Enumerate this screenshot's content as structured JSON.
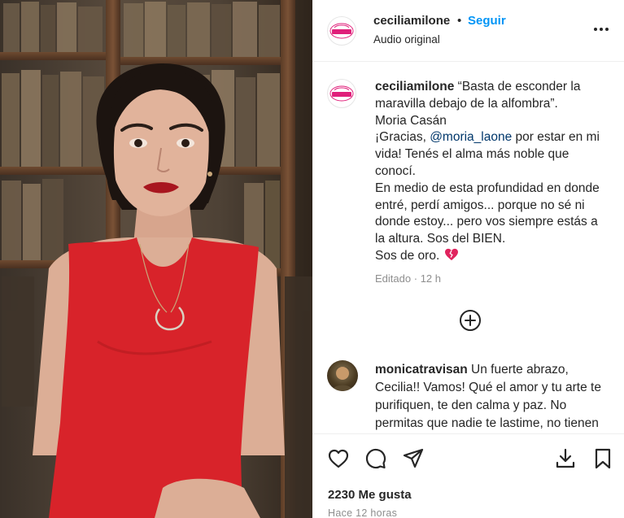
{
  "header": {
    "username": "ceciliamilone",
    "separator": "•",
    "follow_label": "Seguir",
    "audio_label": "Audio original",
    "logo_text": "Cecilia MILONE"
  },
  "caption": {
    "username": "ceciliamilone",
    "lines": [
      "“Basta de esconder la maravilla debajo de la alfombra”.",
      "Moria Casán"
    ],
    "thanks_prefix": "¡Gracias, ",
    "mention": "@moria_laone",
    "thanks_suffix": " por estar en mi vida! Tenés el alma más noble que conocí.",
    "body": "En medio de esta profundidad en donde entré, perdí amigos... porque no sé ni donde estoy... pero vos siempre estás a la altura. Sos del BIEN.",
    "closing": "Sos de oro. ",
    "emoji_icon": "broken-heart-icon",
    "edited": "Editado",
    "meta_separator": "·",
    "edited_time": "12 h"
  },
  "load_more_icon": "plus-circle-icon",
  "comment": {
    "username": "monicatravisan",
    "text": "Un fuerte abrazo, Cecilia!! Vamos! Qué el amor y tu arte te purifiquen, te den calma y paz. No permitas que nadie te lastime, no tienen derecho. Sos única y fuerte!!"
  },
  "actions": {
    "like_icon": "heart-icon",
    "comment_icon": "comment-icon",
    "share_icon": "send-icon",
    "download_icon": "download-icon",
    "save_icon": "bookmark-icon"
  },
  "likes": "2230 Me gusta",
  "posted": "Hace 12 horas",
  "colors": {
    "follow": "#0095f6",
    "text": "#262626",
    "muted": "#8e8e8e",
    "dress": "#d8232a",
    "broken_heart": "#e0245e"
  }
}
